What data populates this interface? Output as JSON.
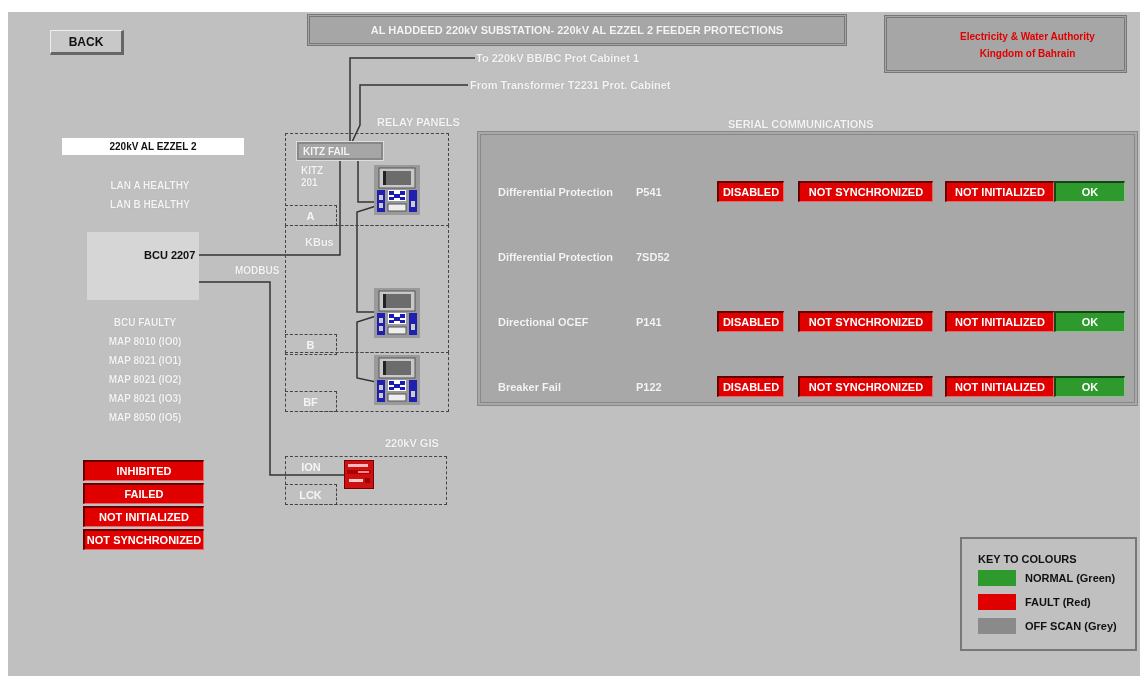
{
  "back_button": "BACK",
  "title": "AL HADDEED 220kV SUBSTATION- 220kV AL EZZEL 2 FEEDER PROTECTIONS",
  "authority": [
    "Electricity & Water Authority",
    "Kingdom of Bahrain"
  ],
  "feeder": {
    "name": "220kV AL EZZEL 2",
    "lan_status": [
      "LAN A HEALTHY",
      "LAN B HEALTHY"
    ]
  },
  "bcu": {
    "label": "BCU 2207",
    "alarms": [
      "BCU FAULTY",
      "MAP 8010 (IO0)",
      "MAP 8021 (IO1)",
      "MAP 8021 (IO2)",
      "MAP 8021 (IO3)",
      "MAP 8050 (IO5)"
    ]
  },
  "status_indicators": [
    {
      "label": "INHIBITED",
      "color": "#e00000"
    },
    {
      "label": "FAILED",
      "color": "#e00000"
    },
    {
      "label": "NOT INITIALIZED",
      "color": "#e00000"
    },
    {
      "label": "NOT SYNCHRONIZED",
      "color": "#e00000"
    }
  ],
  "diagram": {
    "links": [
      "To 220kV BB/BC Prot Cabinet 1",
      "From Transformer T2231 Prot. Cabinet"
    ],
    "relay_panels_title": "RELAY PANELS",
    "kitz_alarm": "KITZ FAIL",
    "kitz": "KITZ 201",
    "bays": [
      "A",
      "B",
      "BF"
    ],
    "kbus": "KBus",
    "modbus": "MODBUS",
    "gis_title": "220kV GIS",
    "gis_bays": [
      "ION",
      "LCK"
    ]
  },
  "serial_communications": {
    "title": "SERIAL COMMUNICATIONS",
    "rows": [
      {
        "name": "Differential Protection",
        "device": "P541",
        "statuses": [
          {
            "label": "DISABLED",
            "color": "#e00000"
          },
          {
            "label": "NOT SYNCHRONIZED",
            "color": "#e00000"
          },
          {
            "label": "NOT INITIALIZED",
            "color": "#e00000"
          },
          {
            "label": "OK",
            "color": "#2e9a2e"
          }
        ]
      },
      {
        "name": "Differential Protection",
        "device": "7SD52",
        "statuses": []
      },
      {
        "name": "Directional OCEF",
        "device": "P141",
        "statuses": [
          {
            "label": "DISABLED",
            "color": "#e00000"
          },
          {
            "label": "NOT SYNCHRONIZED",
            "color": "#e00000"
          },
          {
            "label": "NOT INITIALIZED",
            "color": "#e00000"
          },
          {
            "label": "OK",
            "color": "#2e9a2e"
          }
        ]
      },
      {
        "name": "Breaker Fail",
        "device": "P122",
        "statuses": [
          {
            "label": "DISABLED",
            "color": "#e00000"
          },
          {
            "label": "NOT SYNCHRONIZED",
            "color": "#e00000"
          },
          {
            "label": "NOT INITIALIZED",
            "color": "#e00000"
          },
          {
            "label": "OK",
            "color": "#2e9a2e"
          }
        ]
      }
    ]
  },
  "key": {
    "title": "KEY TO COLOURS",
    "items": [
      {
        "label": "NORMAL (Green)",
        "color": "#2e9a2e"
      },
      {
        "label": "FAULT (Red)",
        "color": "#e00000"
      },
      {
        "label": "OFF SCAN (Grey)",
        "color": "#8a8a8a"
      }
    ]
  }
}
